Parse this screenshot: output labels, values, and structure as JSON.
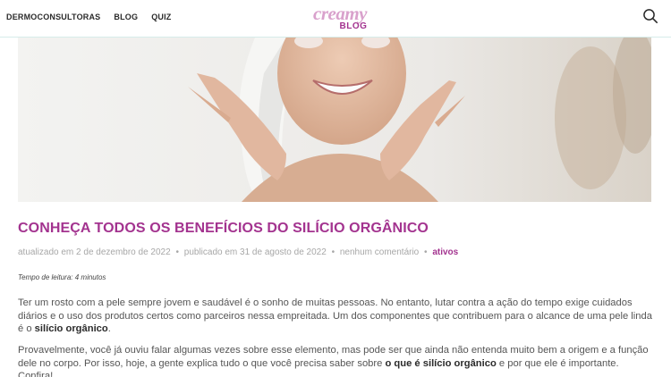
{
  "nav": {
    "items": [
      "DERMOCONSULTORAS",
      "BLOG",
      "QUIZ"
    ]
  },
  "logo": {
    "main": "creamy",
    "sub": "BLOG"
  },
  "icons": {
    "search": "search-icon"
  },
  "colors": {
    "brand": "#a3338f",
    "brand_light": "#d9a1cc",
    "meta_text": "#a7a7a7"
  },
  "article": {
    "title": "CONHEÇA TODOS OS BENEFÍCIOS DO SILÍCIO ORGÂNICO",
    "meta": {
      "updated": "atualizado em 2 de dezembro de 2022",
      "published": "publicado em 31 de agosto de 2022",
      "comments": "nenhum comentário",
      "separator": "•",
      "category": "ativos"
    },
    "read_time": "Tempo de leitura: 4 minutos",
    "p1": {
      "text_a": "Ter um rosto com a pele sempre jovem e saudável é o sonho de muitas pessoas. No entanto, lutar contra a ação do tempo exige cuidados diários e o uso dos produtos certos como parceiros nessa empreitada. Um dos componentes que contribuem para o alcance de uma pele linda é o ",
      "bold": "silício orgânico",
      "text_b": "."
    },
    "p2": {
      "text_a": "Provavelmente, você já ouviu falar algumas vezes sobre esse elemento, mas pode ser que ainda não entenda muito bem a origem e a função dele no corpo. Por isso, hoje, a gente explica tudo o que você precisa saber sobre ",
      "bold": "o que é silício orgânico",
      "text_b": " e por que ele é importante. Confira!"
    }
  }
}
